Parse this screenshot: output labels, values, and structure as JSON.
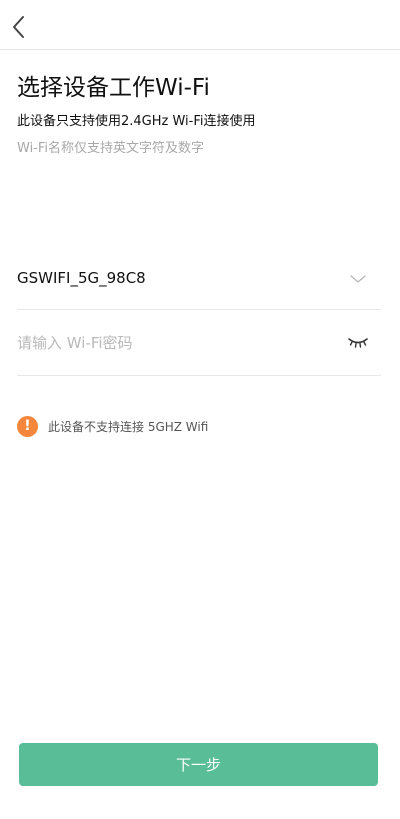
{
  "header": {
    "back_icon": "chevron-left-icon"
  },
  "main": {
    "title": "选择设备工作Wi-Fi",
    "subtitle": "此设备只支持使用2.4GHz Wi-Fi连接使用",
    "hint": "Wi-Fi名称仅支持英文字符及数字"
  },
  "wifi": {
    "selected_ssid": "GSWIFI_5G_98C8",
    "dropdown_icon": "chevron-down-icon"
  },
  "password": {
    "placeholder": "请输入 Wi-Fi密码",
    "value": "",
    "toggle_icon": "eye-closed-icon"
  },
  "warning": {
    "icon": "exclamation-icon",
    "icon_symbol": "!",
    "text": "此设备不支持连接 5GHZ Wifi",
    "icon_color": "#f5873c"
  },
  "footer": {
    "next_label": "下一步",
    "button_color": "#59bd98"
  }
}
